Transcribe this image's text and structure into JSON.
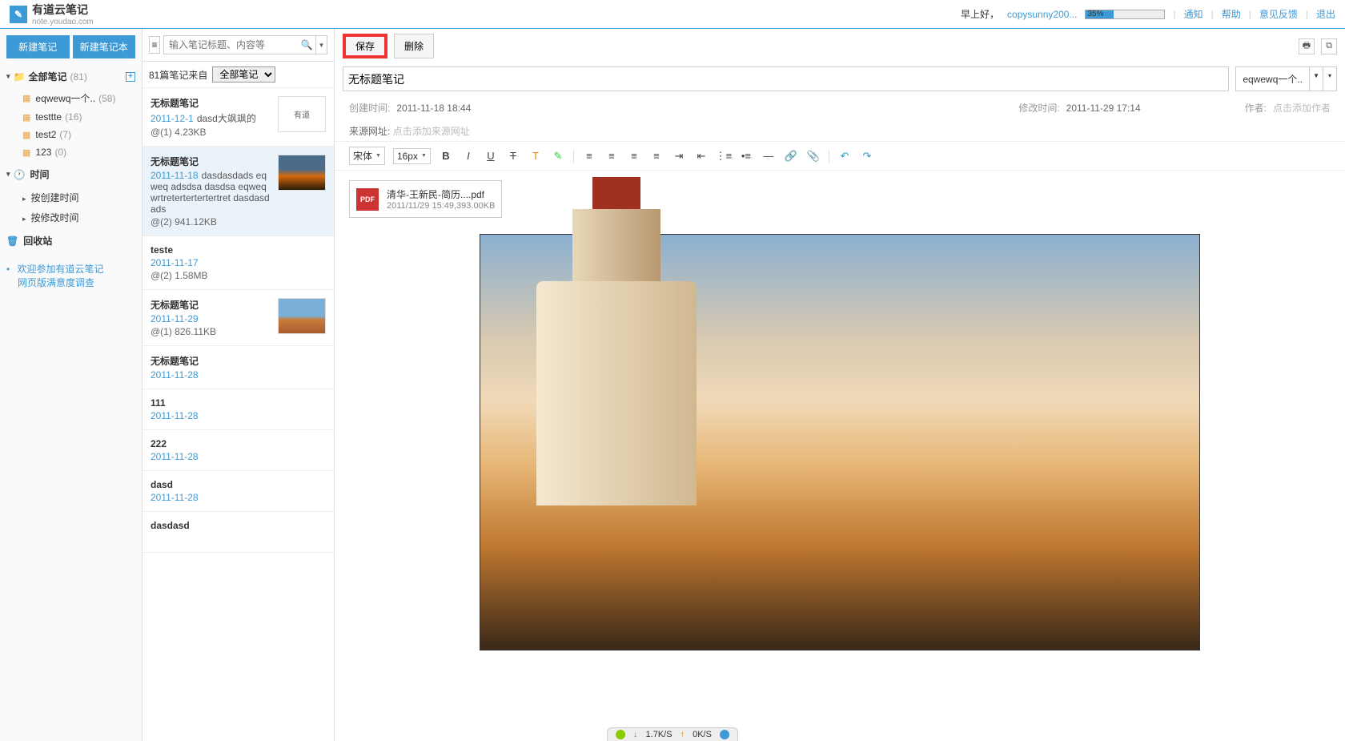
{
  "header": {
    "logo_text": "有道云笔记",
    "logo_sub": "note.youdao.com",
    "greeting": "早上好，",
    "username": "copysunny200...",
    "progress_text": "35%",
    "links": {
      "notify": "通知",
      "help": "帮助",
      "feedback": "意见反馈",
      "logout": "退出"
    }
  },
  "sidebar": {
    "new_note": "新建笔记",
    "new_notebook": "新建笔记本",
    "all_notes": {
      "label": "全部笔记",
      "count": "(81)"
    },
    "notebooks": [
      {
        "name": "eqwewq一个..",
        "count": "(58)"
      },
      {
        "name": "testtte",
        "count": "(16)"
      },
      {
        "name": "test2",
        "count": "(7)"
      },
      {
        "name": "123",
        "count": "(0)"
      }
    ],
    "time_section": "时间",
    "time_items": {
      "by_create": "按创建时间",
      "by_modify": "按修改时间"
    },
    "trash": "回收站",
    "survey": {
      "line1": "欢迎参加有道云笔记",
      "line2": "网页版满意度调查"
    }
  },
  "notelist": {
    "search_placeholder": "输入笔记标题、内容等",
    "filter_prefix": "81篇笔记来自",
    "filter_value": "全部笔记",
    "items": [
      {
        "title": "无标题笔记",
        "date": "2011-12-1",
        "snippet": "dasd大飒飒的",
        "meta": "@(1) 4.23KB",
        "thumb": "logo"
      },
      {
        "title": "无标题笔记",
        "date": "2011-11-18",
        "snippet": "dasdasdads eqweq adsdsa dasdsa eqweqwrtretertertertertret dasdasdads",
        "meta": "@(2) 941.12KB",
        "thumb": "sunset"
      },
      {
        "title": "teste",
        "date": "2011-11-17",
        "snippet": "",
        "meta": "@(2) 1.58MB",
        "thumb": ""
      },
      {
        "title": "无标题笔记",
        "date": "2011-11-29",
        "snippet": "",
        "meta": "@(1) 826.11KB",
        "thumb": "desert"
      },
      {
        "title": "无标题笔记",
        "date": "2011-11-28",
        "snippet": "",
        "meta": "",
        "thumb": ""
      },
      {
        "title": "111",
        "date": "2011-11-28",
        "snippet": "",
        "meta": "",
        "thumb": ""
      },
      {
        "title": "222",
        "date": "2011-11-28",
        "snippet": "",
        "meta": "",
        "thumb": ""
      },
      {
        "title": "dasd",
        "date": "2011-11-28",
        "snippet": "",
        "meta": "",
        "thumb": ""
      },
      {
        "title": "dasdasd",
        "date": "",
        "snippet": "",
        "meta": "",
        "thumb": ""
      }
    ]
  },
  "editor": {
    "save": "保存",
    "delete": "删除",
    "title": "无标题笔记",
    "tag": "eqwewq一个..",
    "meta": {
      "create_label": "创建时间:",
      "create_val": "2011-11-18 18:44",
      "modify_label": "修改时间:",
      "modify_val": "2011-11-29 17:14",
      "author_label": "作者:",
      "author_placeholder": "点击添加作者",
      "source_label": "来源网址:",
      "source_placeholder": "点击添加来源网址"
    },
    "richtext": {
      "font": "宋体",
      "size": "16px"
    },
    "attachment": {
      "name": "清华-王新民-简历....pdf",
      "meta": "2011/11/29 15:49,393.00KB"
    }
  },
  "status": {
    "down": "1.7K/S",
    "up": "0K/S"
  }
}
